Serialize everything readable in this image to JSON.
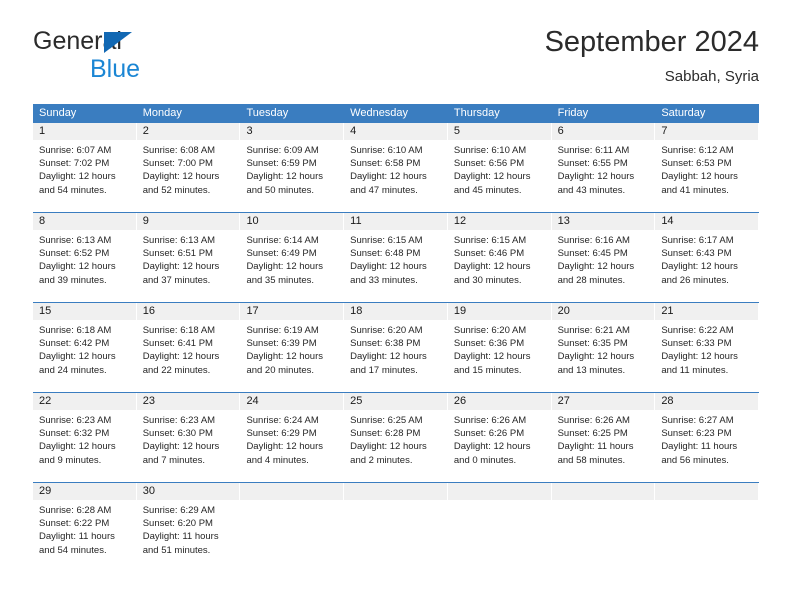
{
  "brand": {
    "name_part1": "General",
    "name_part2": "Blue",
    "triangle_color": "#1268b3",
    "blue_text_color": "#1b86d4"
  },
  "header": {
    "title": "September 2024",
    "subtitle": "Sabbah, Syria"
  },
  "theme": {
    "header_bar": "#3a7dc0",
    "day_number_band": "#f0f0f0",
    "text": "#262626"
  },
  "weekdays": [
    "Sunday",
    "Monday",
    "Tuesday",
    "Wednesday",
    "Thursday",
    "Friday",
    "Saturday"
  ],
  "weeks": [
    [
      {
        "day": "1",
        "sunrise": "Sunrise: 6:07 AM",
        "sunset": "Sunset: 7:02 PM",
        "daylight_line1": "Daylight: 12 hours",
        "daylight_line2": "and 54 minutes."
      },
      {
        "day": "2",
        "sunrise": "Sunrise: 6:08 AM",
        "sunset": "Sunset: 7:00 PM",
        "daylight_line1": "Daylight: 12 hours",
        "daylight_line2": "and 52 minutes."
      },
      {
        "day": "3",
        "sunrise": "Sunrise: 6:09 AM",
        "sunset": "Sunset: 6:59 PM",
        "daylight_line1": "Daylight: 12 hours",
        "daylight_line2": "and 50 minutes."
      },
      {
        "day": "4",
        "sunrise": "Sunrise: 6:10 AM",
        "sunset": "Sunset: 6:58 PM",
        "daylight_line1": "Daylight: 12 hours",
        "daylight_line2": "and 47 minutes."
      },
      {
        "day": "5",
        "sunrise": "Sunrise: 6:10 AM",
        "sunset": "Sunset: 6:56 PM",
        "daylight_line1": "Daylight: 12 hours",
        "daylight_line2": "and 45 minutes."
      },
      {
        "day": "6",
        "sunrise": "Sunrise: 6:11 AM",
        "sunset": "Sunset: 6:55 PM",
        "daylight_line1": "Daylight: 12 hours",
        "daylight_line2": "and 43 minutes."
      },
      {
        "day": "7",
        "sunrise": "Sunrise: 6:12 AM",
        "sunset": "Sunset: 6:53 PM",
        "daylight_line1": "Daylight: 12 hours",
        "daylight_line2": "and 41 minutes."
      }
    ],
    [
      {
        "day": "8",
        "sunrise": "Sunrise: 6:13 AM",
        "sunset": "Sunset: 6:52 PM",
        "daylight_line1": "Daylight: 12 hours",
        "daylight_line2": "and 39 minutes."
      },
      {
        "day": "9",
        "sunrise": "Sunrise: 6:13 AM",
        "sunset": "Sunset: 6:51 PM",
        "daylight_line1": "Daylight: 12 hours",
        "daylight_line2": "and 37 minutes."
      },
      {
        "day": "10",
        "sunrise": "Sunrise: 6:14 AM",
        "sunset": "Sunset: 6:49 PM",
        "daylight_line1": "Daylight: 12 hours",
        "daylight_line2": "and 35 minutes."
      },
      {
        "day": "11",
        "sunrise": "Sunrise: 6:15 AM",
        "sunset": "Sunset: 6:48 PM",
        "daylight_line1": "Daylight: 12 hours",
        "daylight_line2": "and 33 minutes."
      },
      {
        "day": "12",
        "sunrise": "Sunrise: 6:15 AM",
        "sunset": "Sunset: 6:46 PM",
        "daylight_line1": "Daylight: 12 hours",
        "daylight_line2": "and 30 minutes."
      },
      {
        "day": "13",
        "sunrise": "Sunrise: 6:16 AM",
        "sunset": "Sunset: 6:45 PM",
        "daylight_line1": "Daylight: 12 hours",
        "daylight_line2": "and 28 minutes."
      },
      {
        "day": "14",
        "sunrise": "Sunrise: 6:17 AM",
        "sunset": "Sunset: 6:43 PM",
        "daylight_line1": "Daylight: 12 hours",
        "daylight_line2": "and 26 minutes."
      }
    ],
    [
      {
        "day": "15",
        "sunrise": "Sunrise: 6:18 AM",
        "sunset": "Sunset: 6:42 PM",
        "daylight_line1": "Daylight: 12 hours",
        "daylight_line2": "and 24 minutes."
      },
      {
        "day": "16",
        "sunrise": "Sunrise: 6:18 AM",
        "sunset": "Sunset: 6:41 PM",
        "daylight_line1": "Daylight: 12 hours",
        "daylight_line2": "and 22 minutes."
      },
      {
        "day": "17",
        "sunrise": "Sunrise: 6:19 AM",
        "sunset": "Sunset: 6:39 PM",
        "daylight_line1": "Daylight: 12 hours",
        "daylight_line2": "and 20 minutes."
      },
      {
        "day": "18",
        "sunrise": "Sunrise: 6:20 AM",
        "sunset": "Sunset: 6:38 PM",
        "daylight_line1": "Daylight: 12 hours",
        "daylight_line2": "and 17 minutes."
      },
      {
        "day": "19",
        "sunrise": "Sunrise: 6:20 AM",
        "sunset": "Sunset: 6:36 PM",
        "daylight_line1": "Daylight: 12 hours",
        "daylight_line2": "and 15 minutes."
      },
      {
        "day": "20",
        "sunrise": "Sunrise: 6:21 AM",
        "sunset": "Sunset: 6:35 PM",
        "daylight_line1": "Daylight: 12 hours",
        "daylight_line2": "and 13 minutes."
      },
      {
        "day": "21",
        "sunrise": "Sunrise: 6:22 AM",
        "sunset": "Sunset: 6:33 PM",
        "daylight_line1": "Daylight: 12 hours",
        "daylight_line2": "and 11 minutes."
      }
    ],
    [
      {
        "day": "22",
        "sunrise": "Sunrise: 6:23 AM",
        "sunset": "Sunset: 6:32 PM",
        "daylight_line1": "Daylight: 12 hours",
        "daylight_line2": "and 9 minutes."
      },
      {
        "day": "23",
        "sunrise": "Sunrise: 6:23 AM",
        "sunset": "Sunset: 6:30 PM",
        "daylight_line1": "Daylight: 12 hours",
        "daylight_line2": "and 7 minutes."
      },
      {
        "day": "24",
        "sunrise": "Sunrise: 6:24 AM",
        "sunset": "Sunset: 6:29 PM",
        "daylight_line1": "Daylight: 12 hours",
        "daylight_line2": "and 4 minutes."
      },
      {
        "day": "25",
        "sunrise": "Sunrise: 6:25 AM",
        "sunset": "Sunset: 6:28 PM",
        "daylight_line1": "Daylight: 12 hours",
        "daylight_line2": "and 2 minutes."
      },
      {
        "day": "26",
        "sunrise": "Sunrise: 6:26 AM",
        "sunset": "Sunset: 6:26 PM",
        "daylight_line1": "Daylight: 12 hours",
        "daylight_line2": "and 0 minutes."
      },
      {
        "day": "27",
        "sunrise": "Sunrise: 6:26 AM",
        "sunset": "Sunset: 6:25 PM",
        "daylight_line1": "Daylight: 11 hours",
        "daylight_line2": "and 58 minutes."
      },
      {
        "day": "28",
        "sunrise": "Sunrise: 6:27 AM",
        "sunset": "Sunset: 6:23 PM",
        "daylight_line1": "Daylight: 11 hours",
        "daylight_line2": "and 56 minutes."
      }
    ],
    [
      {
        "day": "29",
        "sunrise": "Sunrise: 6:28 AM",
        "sunset": "Sunset: 6:22 PM",
        "daylight_line1": "Daylight: 11 hours",
        "daylight_line2": "and 54 minutes."
      },
      {
        "day": "30",
        "sunrise": "Sunrise: 6:29 AM",
        "sunset": "Sunset: 6:20 PM",
        "daylight_line1": "Daylight: 11 hours",
        "daylight_line2": "and 51 minutes."
      },
      {
        "day": "",
        "sunrise": "",
        "sunset": "",
        "daylight_line1": "",
        "daylight_line2": ""
      },
      {
        "day": "",
        "sunrise": "",
        "sunset": "",
        "daylight_line1": "",
        "daylight_line2": ""
      },
      {
        "day": "",
        "sunrise": "",
        "sunset": "",
        "daylight_line1": "",
        "daylight_line2": ""
      },
      {
        "day": "",
        "sunrise": "",
        "sunset": "",
        "daylight_line1": "",
        "daylight_line2": ""
      },
      {
        "day": "",
        "sunrise": "",
        "sunset": "",
        "daylight_line1": "",
        "daylight_line2": ""
      }
    ]
  ]
}
